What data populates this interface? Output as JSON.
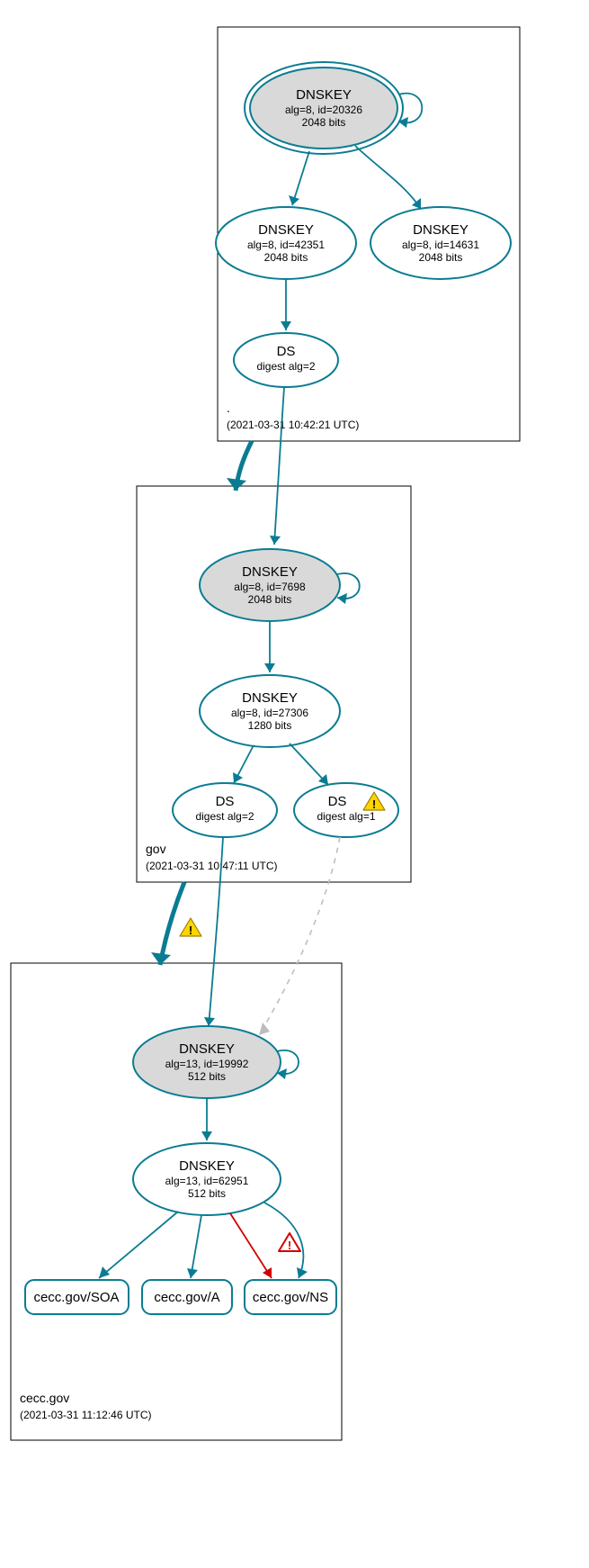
{
  "zones": {
    "root": {
      "label": ".",
      "timestamp": "(2021-03-31 10:42:21 UTC)"
    },
    "gov": {
      "label": "gov",
      "timestamp": "(2021-03-31 10:47:11 UTC)"
    },
    "cecc": {
      "label": "cecc.gov",
      "timestamp": "(2021-03-31 11:12:46 UTC)"
    }
  },
  "nodes": {
    "root_ksk": {
      "title": "DNSKEY",
      "l1": "alg=8, id=20326",
      "l2": "2048 bits"
    },
    "root_zsk1": {
      "title": "DNSKEY",
      "l1": "alg=8, id=42351",
      "l2": "2048 bits"
    },
    "root_zsk2": {
      "title": "DNSKEY",
      "l1": "alg=8, id=14631",
      "l2": "2048 bits"
    },
    "root_ds": {
      "title": "DS",
      "l1": "digest alg=2"
    },
    "gov_ksk": {
      "title": "DNSKEY",
      "l1": "alg=8, id=7698",
      "l2": "2048 bits"
    },
    "gov_zsk": {
      "title": "DNSKEY",
      "l1": "alg=8, id=27306",
      "l2": "1280 bits"
    },
    "gov_ds1": {
      "title": "DS",
      "l1": "digest alg=2"
    },
    "gov_ds2": {
      "title": "DS",
      "l1": "digest alg=1"
    },
    "cecc_ksk": {
      "title": "DNSKEY",
      "l1": "alg=13, id=19992",
      "l2": "512 bits"
    },
    "cecc_zsk": {
      "title": "DNSKEY",
      "l1": "alg=13, id=62951",
      "l2": "512 bits"
    },
    "rr_soa": {
      "title": "cecc.gov/SOA"
    },
    "rr_a": {
      "title": "cecc.gov/A"
    },
    "rr_ns": {
      "title": "cecc.gov/NS"
    }
  }
}
